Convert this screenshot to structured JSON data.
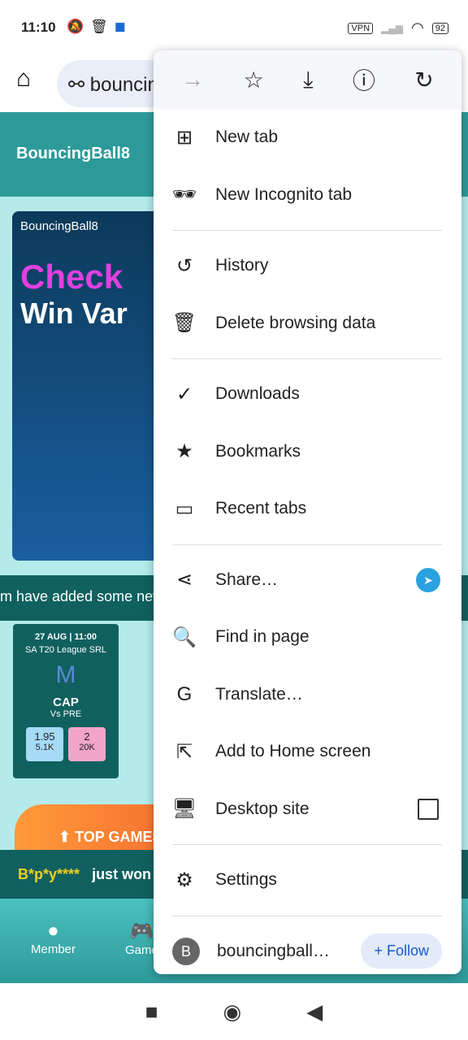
{
  "status": {
    "time": "11:10",
    "vpn": "VPN",
    "battery": "92"
  },
  "toolbar": {
    "url": "bouncin"
  },
  "page": {
    "brand": "BouncingBall8",
    "banner_brand": "BouncingBall8",
    "banner_t1": "Check",
    "banner_t2": "Win Var",
    "marquee": "m have added some new g",
    "card": {
      "date": "27 AUG | 11:00",
      "league": "SA T20 League SRL",
      "team": "CAP",
      "vs": "Vs PRE",
      "odd1": "1.95",
      "vol1": "5.1K",
      "odd2": "2",
      "vol2": "20K"
    },
    "top_games": "TOP GAMES",
    "winner": "B*p*y****",
    "just_won": "just won",
    "nav": [
      "Member",
      "Game"
    ]
  },
  "menu": {
    "items": [
      {
        "icon": "new-tab-icon",
        "glyph": "⊞",
        "label": "New tab"
      },
      {
        "icon": "incognito-icon",
        "glyph": "🕶",
        "label": "New Incognito tab"
      },
      {
        "icon": "history-icon",
        "glyph": "↺",
        "label": "History"
      },
      {
        "icon": "trash-icon",
        "glyph": "🗑",
        "label": "Delete browsing data"
      },
      {
        "icon": "downloads-icon",
        "glyph": "✓",
        "label": "Downloads"
      },
      {
        "icon": "bookmarks-icon",
        "glyph": "★",
        "label": "Bookmarks"
      },
      {
        "icon": "devices-icon",
        "glyph": "▭",
        "label": "Recent tabs"
      },
      {
        "icon": "share-icon",
        "glyph": "⋖",
        "label": "Share…"
      },
      {
        "icon": "find-icon",
        "glyph": "🔍",
        "label": "Find in page"
      },
      {
        "icon": "translate-icon",
        "glyph": "G",
        "label": "Translate…"
      },
      {
        "icon": "add-home-icon",
        "glyph": "⇱",
        "label": "Add to Home screen"
      },
      {
        "icon": "desktop-icon",
        "glyph": "🖥",
        "label": "Desktop site"
      },
      {
        "icon": "settings-icon",
        "glyph": "⚙",
        "label": "Settings"
      }
    ],
    "site": {
      "avatar": "B",
      "label": "bouncingball…",
      "follow": "+ Follow"
    }
  }
}
